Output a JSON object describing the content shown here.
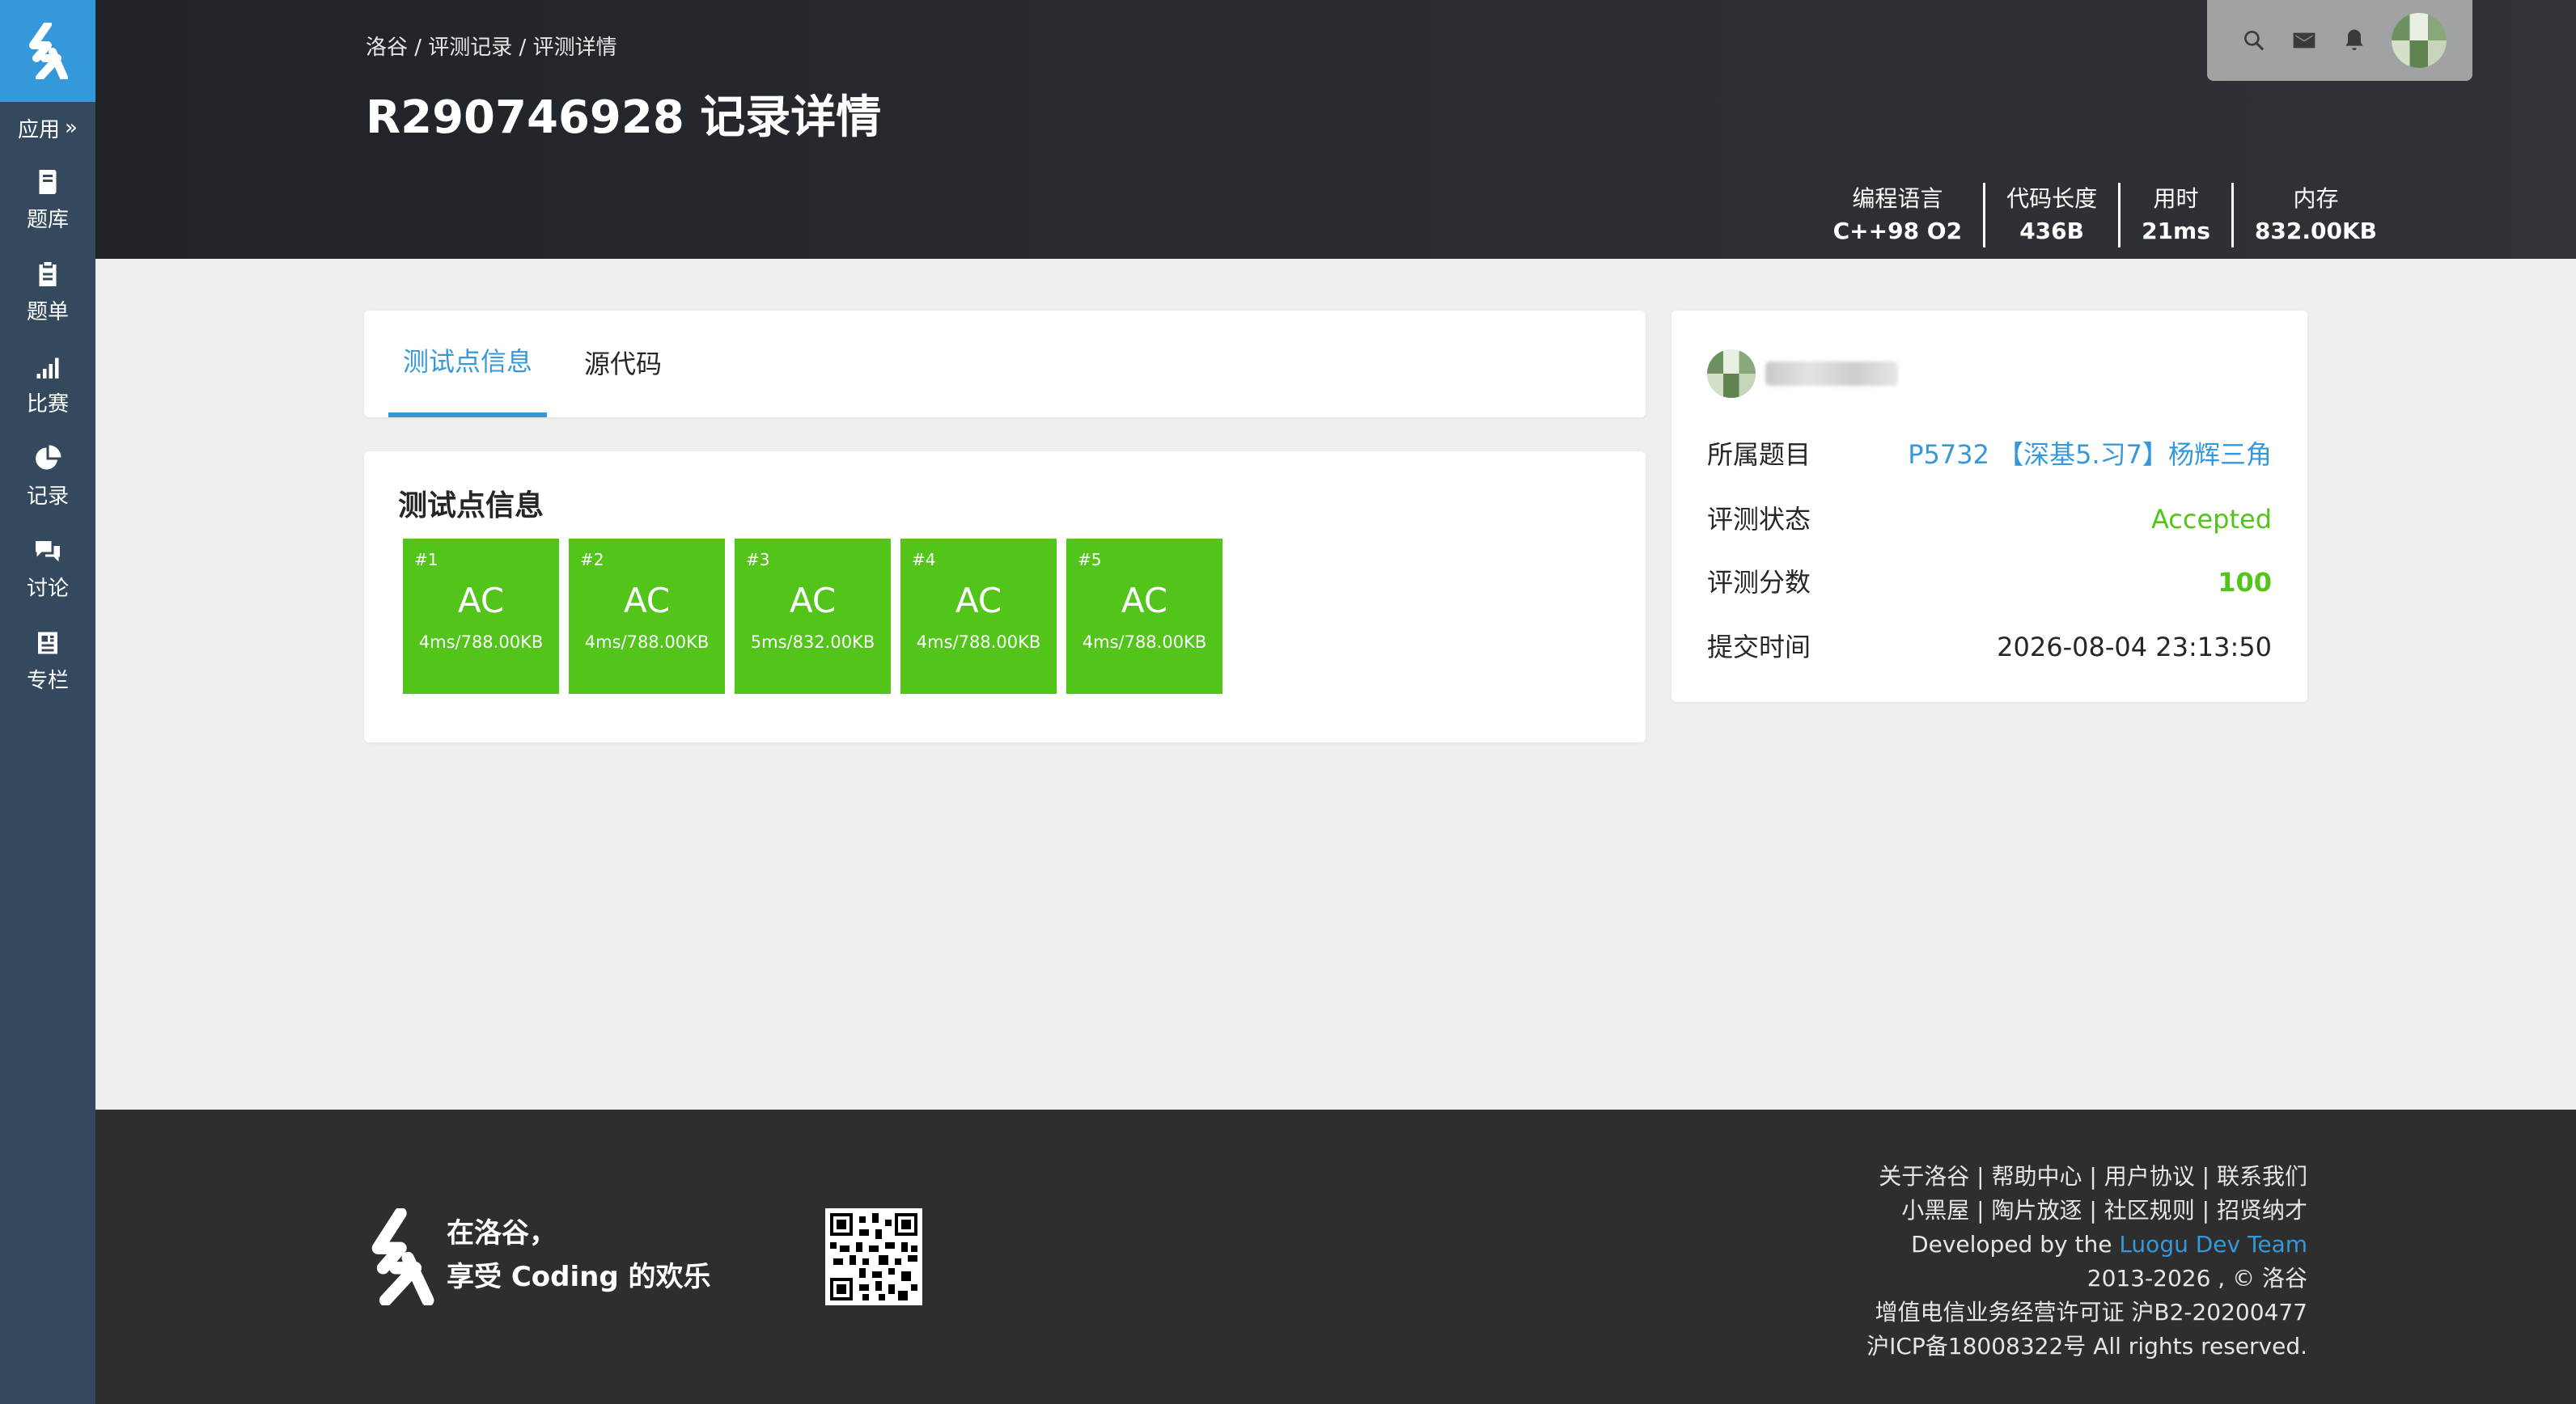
{
  "sidebar": {
    "apps_label": "应用",
    "items": [
      {
        "label": "题库",
        "icon": "book-icon"
      },
      {
        "label": "题单",
        "icon": "clipboard-icon"
      },
      {
        "label": "比赛",
        "icon": "signal-bars-icon"
      },
      {
        "label": "记录",
        "icon": "pie-chart-icon"
      },
      {
        "label": "讨论",
        "icon": "chat-bubbles-icon"
      },
      {
        "label": "专栏",
        "icon": "newspaper-icon"
      }
    ]
  },
  "header": {
    "breadcrumb": "洛谷 / 评测记录 / 评测详情",
    "title": "R290746928 记录详情",
    "stats": [
      {
        "label": "编程语言",
        "value": "C++98 O2"
      },
      {
        "label": "代码长度",
        "value": "436B"
      },
      {
        "label": "用时",
        "value": "21ms"
      },
      {
        "label": "内存",
        "value": "832.00KB"
      }
    ]
  },
  "tabs": [
    {
      "label": "测试点信息",
      "active": true
    },
    {
      "label": "源代码",
      "active": false
    }
  ],
  "tests": {
    "title": "测试点信息",
    "items": [
      {
        "num": "#1",
        "status": "AC",
        "detail": "4ms/788.00KB"
      },
      {
        "num": "#2",
        "status": "AC",
        "detail": "4ms/788.00KB"
      },
      {
        "num": "#3",
        "status": "AC",
        "detail": "5ms/832.00KB"
      },
      {
        "num": "#4",
        "status": "AC",
        "detail": "4ms/788.00KB"
      },
      {
        "num": "#5",
        "status": "AC",
        "detail": "4ms/788.00KB"
      }
    ]
  },
  "info": {
    "problem_label": "所属题目",
    "problem_value": "P5732 【深基5.习7】杨辉三角",
    "status_label": "评测状态",
    "status_value": "Accepted",
    "score_label": "评测分数",
    "score_value": "100",
    "time_label": "提交时间",
    "time_value": "2026-08-04 23:13:50"
  },
  "footer": {
    "slogan_line1": "在洛谷，",
    "slogan_line2": "享受 Coding 的欢乐",
    "links_row1": [
      "关于洛谷",
      "帮助中心",
      "用户协议",
      "联系我们"
    ],
    "links_row2": [
      "小黑屋",
      "陶片放逐",
      "社区规则",
      "招贤纳才"
    ],
    "developed_prefix": "Developed by the ",
    "developed_team": "Luogu Dev Team",
    "copyright": "2013-2026 , © 洛谷",
    "license": "增值电信业务经营许可证 沪B2-20200477",
    "icp": "沪ICP备18008322号 All rights reserved."
  },
  "colors": {
    "accent": "#3498db",
    "success": "#52c41a",
    "sidebar": "#34495e",
    "footer": "#2e2e2e"
  }
}
